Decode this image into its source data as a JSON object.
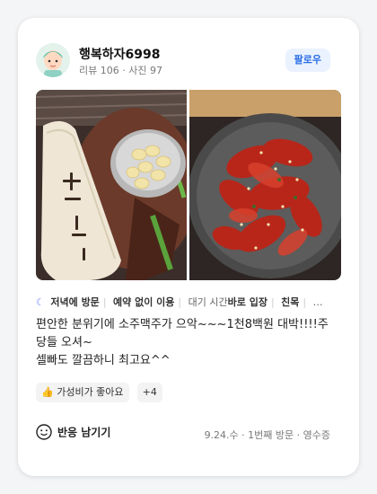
{
  "review": {
    "user": {
      "name": "행복하자6998",
      "stats": "리뷰 106 · 사진 97"
    },
    "follow_label": "팔로우",
    "tags": [
      {
        "text": "저녁에 방문",
        "bold": true
      },
      {
        "text": "예약 없이 이용",
        "bold": true
      },
      {
        "text": "대기 시간 ",
        "bold": false
      },
      {
        "text": "바로 입장",
        "bold": true
      },
      {
        "text": "친목",
        "bold": true
      }
    ],
    "more": "…",
    "text": "편안한 분위기에 소주맥주가 으악~~~1천8백원 대박!!!!주\n당들 오셔~\n셀빠도 깔끔하니 최고요^^",
    "chips": [
      {
        "emoji": "👍",
        "label": "가성비가 좋아요"
      }
    ],
    "chip_more": "+4",
    "react_label": "반응 남기기",
    "footer_meta": "9.24.수 · 1번째 방문 · 영수증",
    "icons": [
      "moon-icon",
      "thumbs-up-icon",
      "smile-icon"
    ]
  }
}
